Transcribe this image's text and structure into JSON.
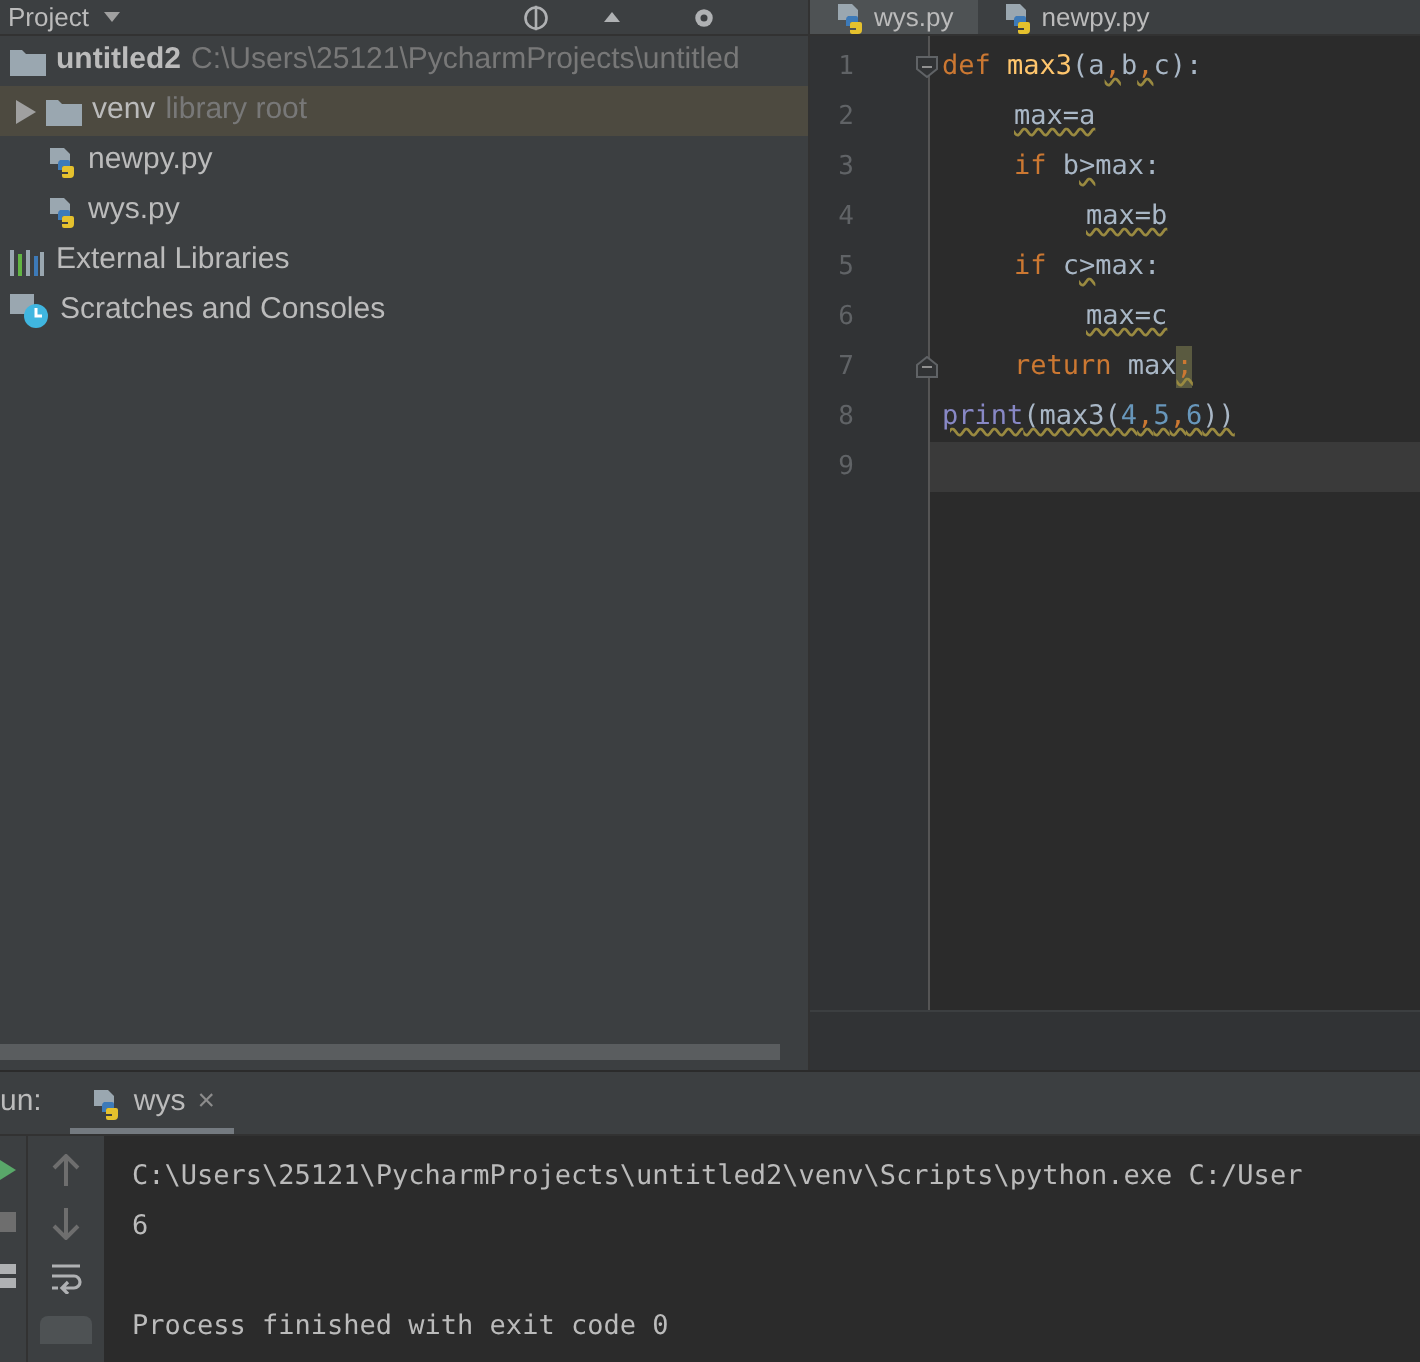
{
  "project_panel": {
    "title": "Project",
    "tree": [
      {
        "label": "untitled2",
        "detail": "C:\\Users\\25121\\PycharmProjects\\untitled",
        "kind": "project",
        "selected": false,
        "children": [
          {
            "label": "venv",
            "detail": "library root",
            "kind": "folder",
            "selected": true,
            "expanded": false
          },
          {
            "label": "newpy.py",
            "kind": "python-file",
            "selected": false
          },
          {
            "label": "wys.py",
            "kind": "python-file",
            "selected": false
          }
        ]
      },
      {
        "label": "External Libraries",
        "kind": "libraries",
        "selected": false
      },
      {
        "label": "Scratches and Consoles",
        "kind": "scratches",
        "selected": false
      }
    ]
  },
  "editor": {
    "tabs": [
      {
        "label": "wys.py",
        "selected": true
      },
      {
        "label": "newpy.py",
        "selected": false
      }
    ],
    "lines": [
      {
        "number": "1",
        "current": false,
        "fold_open": true,
        "tokens": [
          {
            "kind": "keyword",
            "text": "def "
          },
          {
            "kind": "function",
            "text": "max3"
          },
          {
            "kind": "plain",
            "text": "(a"
          },
          {
            "kind": "punct",
            "text": ",",
            "squiggle": true
          },
          {
            "kind": "plain",
            "text": "b"
          },
          {
            "kind": "punct",
            "text": ",",
            "squiggle": true
          },
          {
            "kind": "plain",
            "text": "c):"
          }
        ],
        "children": [
          {
            "number": "2",
            "current": false,
            "tokens": [
              {
                "kind": "plain",
                "text": "max=a",
                "squiggle": true
              }
            ]
          },
          {
            "number": "3",
            "current": false,
            "tokens": [
              {
                "kind": "keyword",
                "text": "if "
              },
              {
                "kind": "plain",
                "text": "b"
              },
              {
                "kind": "plain",
                "text": ">",
                "squiggle": true
              },
              {
                "kind": "plain",
                "text": "max:"
              }
            ],
            "children": [
              {
                "number": "4",
                "current": false,
                "tokens": [
                  {
                    "kind": "plain",
                    "text": "max=b",
                    "squiggle": true
                  }
                ]
              }
            ]
          },
          {
            "number": "5",
            "current": false,
            "tokens": [
              {
                "kind": "keyword",
                "text": "if "
              },
              {
                "kind": "plain",
                "text": "c"
              },
              {
                "kind": "plain",
                "text": ">",
                "squiggle": true
              },
              {
                "kind": "plain",
                "text": "max:"
              }
            ],
            "children": [
              {
                "number": "6",
                "current": false,
                "tokens": [
                  {
                    "kind": "plain",
                    "text": "max=c",
                    "squiggle": true
                  }
                ]
              }
            ]
          },
          {
            "number": "7",
            "current": false,
            "fold_close": true,
            "tokens": [
              {
                "kind": "keyword",
                "text": "return "
              },
              {
                "kind": "plain",
                "text": "max"
              },
              {
                "kind": "punct",
                "text": ";",
                "squiggle": true,
                "highlight": true
              }
            ]
          }
        ]
      },
      {
        "number": "8",
        "current": false,
        "tokens": [
          {
            "kind": "builtin",
            "text": "print",
            "squiggle": true
          },
          {
            "kind": "plain",
            "text": "(max3(",
            "squiggle": true
          },
          {
            "kind": "number",
            "text": "4",
            "squiggle": true
          },
          {
            "kind": "punct",
            "text": ",",
            "squiggle": true
          },
          {
            "kind": "number",
            "text": "5",
            "squiggle": true
          },
          {
            "kind": "punct",
            "text": ",",
            "squiggle": true
          },
          {
            "kind": "number",
            "text": "6",
            "squiggle": true
          },
          {
            "kind": "plain",
            "text": "))",
            "squiggle": true
          }
        ]
      },
      {
        "number": "9",
        "current": true
      }
    ]
  },
  "run_panel": {
    "label": "un:",
    "tabs": [
      {
        "label": "wys",
        "selected": true,
        "close": "×"
      }
    ],
    "console": [
      {
        "kind": "output",
        "text": "C:\\Users\\25121\\PycharmProjects\\untitled2\\venv\\Scripts\\python.exe C:/User"
      },
      {
        "kind": "output",
        "text": "6"
      },
      {
        "kind": "status",
        "text": "Process finished with exit code 0"
      }
    ]
  }
}
